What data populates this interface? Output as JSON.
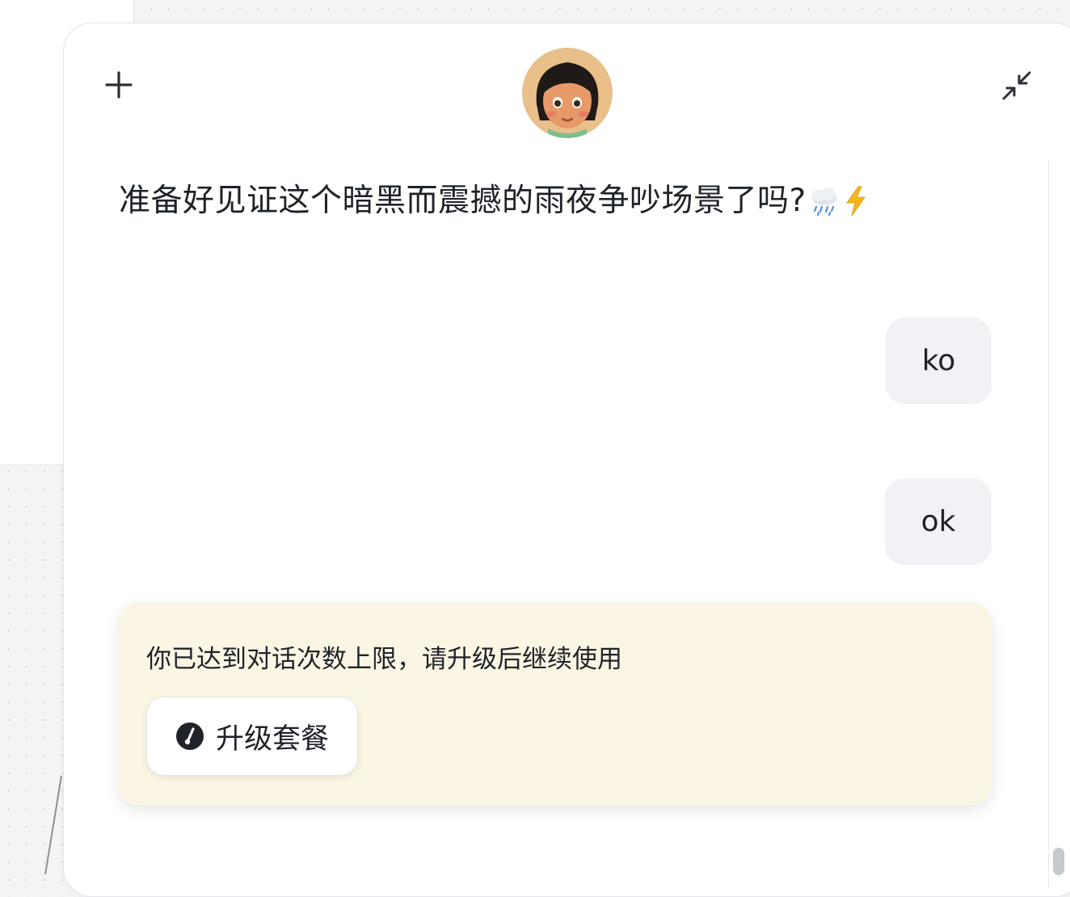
{
  "header": {
    "new_chat_icon": "plus-icon",
    "collapse_icon": "collapse-arrows-icon",
    "avatar_icon": "girl-avatar"
  },
  "messages": [
    {
      "role": "assistant",
      "text": "准备好见证这个暗黑而震撼的雨夜争吵场景了吗?",
      "emojis": [
        "cloud-rain-icon",
        "lightning-icon"
      ]
    },
    {
      "role": "user",
      "text": "ko"
    },
    {
      "role": "user",
      "text": "ok"
    }
  ],
  "limit_notice": {
    "text": "你已达到对话次数上限，请升级后继续使用",
    "button_label": "升级套餐",
    "button_icon": "gauge-icon"
  },
  "colors": {
    "notice_bg": "#fbf6e4",
    "bubble_bg": "#f1f2f5",
    "text": "#1e2329"
  }
}
